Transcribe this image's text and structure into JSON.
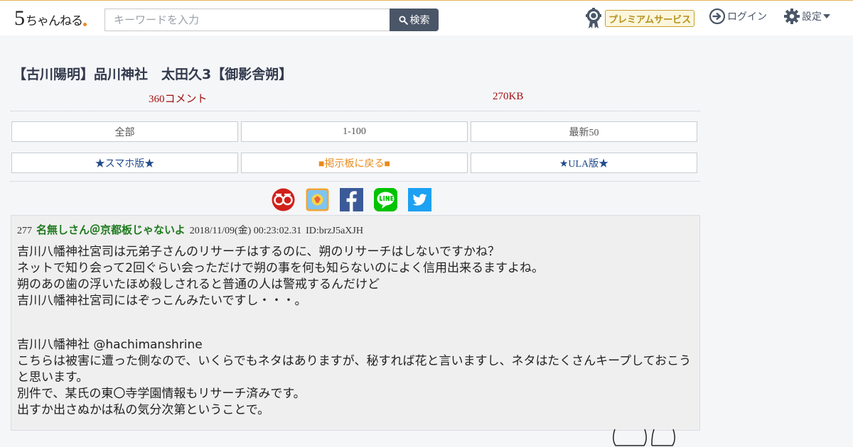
{
  "header": {
    "logo_text": "5ちゃんねる",
    "search_placeholder": "キーワードを入力",
    "search_button": "検索",
    "premium_label": "プレミアムサービス",
    "login_label": "ログイン",
    "settings_label": "設定"
  },
  "thread": {
    "title": "【古川陽明】品川神社　太田久3【御影舎朔】",
    "comment_count": "360コメント",
    "size": "270KB"
  },
  "nav": {
    "row1": [
      "全部",
      "1-100",
      "最新50"
    ],
    "row2": [
      "★スマホ版★",
      "■掲示板に戻る■",
      "★ULA版★"
    ]
  },
  "share_icons": [
    "matome-icon",
    "blog-icon",
    "facebook-icon",
    "line-icon",
    "twitter-icon"
  ],
  "post": {
    "number": "277",
    "name": "名無しさん＠京都板じゃないよ",
    "date": "2018/11/09(金) 00:23:02.31",
    "id": "ID:brzJ5aXJH",
    "lines": [
      "吉川八幡神社宮司は元弟子さんのリサーチはするのに、朔のリサーチはしないですかね？",
      "ネットで知り会って2回ぐらい会っただけで朔の事を何も知らないのによく信用出来るますよね。",
      "朔のあの歯の浮いたほめ殺しされると普通の人は警戒するんだけど",
      "吉川八幡神社宮司にはぞっこんみたいですし・・・。"
    ],
    "lines2": [
      "吉川八幡神社 @hachimanshrine",
      "こちらは被害に遭った側なので、いくらでもネタはありますが、秘すれば花と言いますし、ネタはたくさんキープしておこうと思います。",
      "別件で、某氏の東〇寺学園情報もリサーチ済みです。",
      "出すか出さぬかは私の気分次第ということで。"
    ]
  },
  "colors": {
    "title": "#333a4d",
    "meta_red": "#a01010",
    "name_green": "#1f7a1f",
    "premium_gold": "#c5a12c",
    "search_button_bg": "#4a5668"
  }
}
